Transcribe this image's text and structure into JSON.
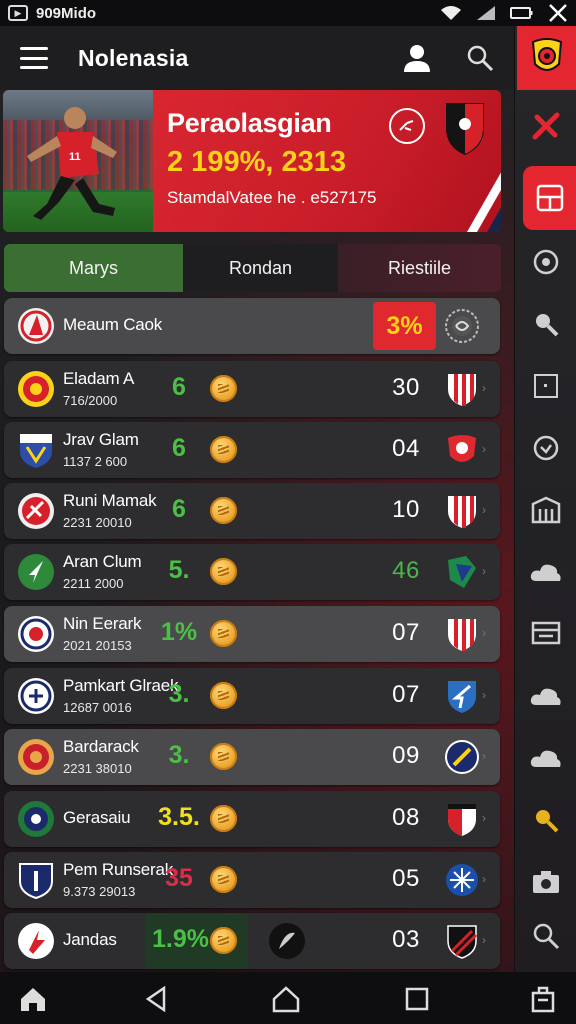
{
  "status_bar": {
    "time": "909Mido"
  },
  "app": {
    "title": "Nolenasia"
  },
  "hero": {
    "title": "Peraolasgian",
    "value": "2 199%, 2313",
    "subtitle": "StamdalVatee he . e527175"
  },
  "tabs": [
    {
      "label": "Marys",
      "active": true
    },
    {
      "label": "Rondan",
      "active": false
    },
    {
      "label": "Riestiile",
      "active": false
    }
  ],
  "rows": [
    {
      "name": "Meaum Caok",
      "sub": "",
      "stat": "",
      "score": "3%",
      "crest": "red-flame-crest",
      "team2": "grey-spiral-badge"
    },
    {
      "name": "Eladam A",
      "sub": "716/2000",
      "stat": "6",
      "stat_color": "#4cbf47",
      "score": "30",
      "crest": "yellow-red-crest",
      "team2": "red-white-shield"
    },
    {
      "name": "Jrav Glam",
      "sub": "1137 2 600",
      "stat": "6",
      "stat_color": "#4cbf47",
      "score": "04",
      "crest": "blue-shield-crest",
      "team2": "red-circle-badge"
    },
    {
      "name": "Runi Mamak",
      "sub": "2231 20010",
      "stat": "6",
      "stat_color": "#4cbf47",
      "score": "10",
      "crest": "red-eagle-crest",
      "team2": "red-white-shield"
    },
    {
      "name": "Aran Clum",
      "sub": "2211 2000",
      "stat": "5.",
      "stat_color": "#4cbf47",
      "score": "46",
      "score_color": "#49b84c",
      "crest": "green-arrow-crest",
      "team2": "green-blue-badge"
    },
    {
      "name": "Nin Eerark",
      "sub": "2021 20153",
      "stat": "1%",
      "stat_color": "#4cbf47",
      "score": "07",
      "crest": "navy-round-crest",
      "team2": "red-white-shield"
    },
    {
      "name": "Pamkart Glraek",
      "sub": "12687 0016",
      "stat": "3.",
      "stat_color": "#4cbf47",
      "score": "07",
      "crest": "navy-round-crest",
      "team2": "blue-arrow-shield"
    },
    {
      "name": "Bardarack",
      "sub": "2231 38010",
      "stat": "3.",
      "stat_color": "#4cbf47",
      "score": "09",
      "crest": "orange-round-crest",
      "team2": "blue-round-badge"
    },
    {
      "name": "Gerasaiu",
      "sub": "",
      "stat": "3.5.",
      "stat_color": "#f2e01e",
      "score": "08",
      "crest": "green-round-crest",
      "team2": "red-stripe-shield"
    },
    {
      "name": "Pem Runserak",
      "sub": "9.373 29013",
      "stat": "35",
      "stat_color": "#e02b45",
      "score": "05",
      "crest": "navy-shield-crest",
      "team2": "blue-star-badge"
    },
    {
      "name": "Jandas",
      "sub": "",
      "stat": "1.9%",
      "stat_color": "#4cbf47",
      "score": "03",
      "crest": "red-letter-crest",
      "team2": "black-red-shield"
    }
  ],
  "rail_icons": [
    "club-crest-icon",
    "crossed-tools-icon",
    "dashboard-icon",
    "target-icon",
    "search-icon",
    "square-icon",
    "clock-icon",
    "stadium-icon",
    "cloud-icon",
    "screen-icon",
    "cloud-icon",
    "cloud-icon",
    "search-icon",
    "camera-icon",
    "search-icon"
  ],
  "colors": {
    "accent_red": "#e3262f",
    "gold": "#ffd21a",
    "green_tab": "#3b6e33",
    "stat_green": "#4cbf47"
  }
}
